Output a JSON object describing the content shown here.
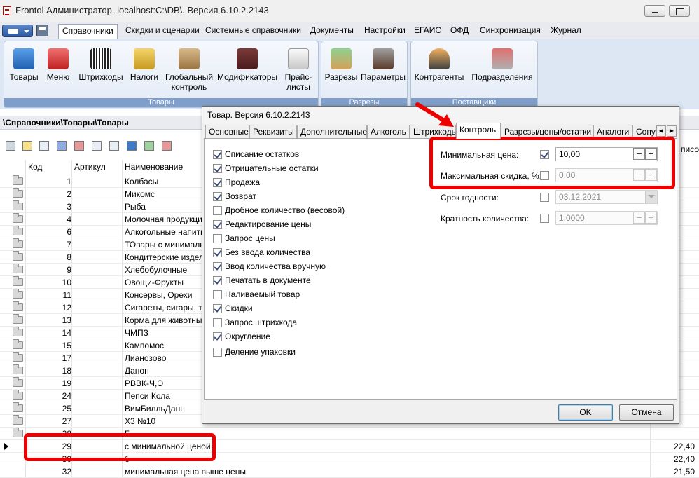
{
  "window": {
    "title": "Frontol Администратор. localhost:C:\\DB\\. Версия 6.10.2.2143"
  },
  "menu": {
    "tabs": [
      {
        "label": "Справочники",
        "active": true
      },
      {
        "label": "Скидки и сценарии"
      },
      {
        "label": "Системные справочники"
      },
      {
        "label": "Документы"
      },
      {
        "label": "Настройки"
      },
      {
        "label": "ЕГАИС"
      },
      {
        "label": "ОФД"
      },
      {
        "label": "Синхронизация"
      },
      {
        "label": "Журнал"
      }
    ]
  },
  "ribbon": {
    "groups": [
      {
        "label": "Товары",
        "buttons": [
          {
            "line1": "Товары",
            "line2": ""
          },
          {
            "line1": "Меню",
            "line2": ""
          },
          {
            "line1": "Штрихкоды",
            "line2": ""
          },
          {
            "line1": "Налоги",
            "line2": ""
          },
          {
            "line1": "Глобальный",
            "line2": "контроль"
          },
          {
            "line1": "Модификаторы",
            "line2": ""
          },
          {
            "line1": "Прайс-",
            "line2": "листы"
          }
        ]
      },
      {
        "label": "Разрезы",
        "buttons": [
          {
            "line1": "Разрезы",
            "line2": ""
          },
          {
            "line1": "Параметры",
            "line2": ""
          }
        ]
      },
      {
        "label": "Поставщики",
        "buttons": [
          {
            "line1": "Контрагенты",
            "line2": ""
          },
          {
            "line1": "Подразделения",
            "line2": ""
          }
        ]
      }
    ]
  },
  "breadcrumb": "\\Справочники\\Товары\\Товары",
  "grid": {
    "columns": {
      "code": "Код",
      "article": "Артикул",
      "name": "Наименование",
      "right_cut": "писок"
    },
    "rows": [
      {
        "code": "1",
        "name": "Колбасы",
        "price": ""
      },
      {
        "code": "2",
        "name": "Микомс",
        "price": ""
      },
      {
        "code": "3",
        "name": "Рыба",
        "price": ""
      },
      {
        "code": "4",
        "name": "Молочная продукция",
        "price": ""
      },
      {
        "code": "6",
        "name": "Алкогольные напитки",
        "price": ""
      },
      {
        "code": "7",
        "name": "ТОвары с минимальной",
        "price": ""
      },
      {
        "code": "8",
        "name": "Кондитерские изделия",
        "price": ""
      },
      {
        "code": "9",
        "name": "Хлебобулочные",
        "price": ""
      },
      {
        "code": "10",
        "name": "Овощи-Фрукты",
        "price": ""
      },
      {
        "code": "11",
        "name": "Консервы, Орехи",
        "price": ""
      },
      {
        "code": "12",
        "name": "Сигареты, сигары, табак",
        "price": ""
      },
      {
        "code": "13",
        "name": "Корма для животных",
        "price": ""
      },
      {
        "code": "14",
        "name": "ЧМПЗ",
        "price": ""
      },
      {
        "code": "15",
        "name": "Кампомос",
        "price": ""
      },
      {
        "code": "17",
        "name": "Лианозово",
        "price": ""
      },
      {
        "code": "18",
        "name": "Данон",
        "price": ""
      },
      {
        "code": "19",
        "name": "РВВК-Ч,Э",
        "price": ""
      },
      {
        "code": "24",
        "name": "Пепси Кола",
        "price": ""
      },
      {
        "code": "25",
        "name": "ВимБилльДанн",
        "price": ""
      },
      {
        "code": "27",
        "name": "Х3 №10",
        "price": ""
      },
      {
        "code": "28",
        "name": "Б",
        "price": ""
      },
      {
        "code": "29",
        "name": "с минимальной ценой",
        "price": "22,40",
        "selected": true
      },
      {
        "code": "30",
        "name": "б",
        "price": "22,40"
      },
      {
        "code": "32",
        "name": "минимальная цена выше цены",
        "price": "21,50"
      }
    ]
  },
  "dialog": {
    "title": "Товар. Версия 6.10.2.2143",
    "tabs": [
      {
        "label": "Основные"
      },
      {
        "label": "Реквизиты"
      },
      {
        "label": "Дополнительные"
      },
      {
        "label": "Алкоголь"
      },
      {
        "label": "Штрихкоды"
      },
      {
        "label": "Контроль",
        "active": true
      },
      {
        "label": "Разрезы/цены/остатки"
      },
      {
        "label": "Аналоги"
      },
      {
        "label": "Сопут"
      }
    ],
    "checkboxes": [
      {
        "label": "Списание остатков",
        "checked": true
      },
      {
        "label": "Отрицательные остатки",
        "checked": true
      },
      {
        "label": "Продажа",
        "checked": true
      },
      {
        "label": "Возврат",
        "checked": true
      },
      {
        "label": "Дробное количество (весовой)",
        "checked": false
      },
      {
        "label": "Редактирование цены",
        "checked": true
      },
      {
        "label": "Запрос цены",
        "checked": false
      },
      {
        "label": "Без ввода количества",
        "checked": true
      },
      {
        "label": "Ввод количества вручную",
        "checked": true
      },
      {
        "label": "Печатать в документе",
        "checked": true
      },
      {
        "label": "Наливаемый товар",
        "checked": false
      },
      {
        "label": "Скидки",
        "checked": true
      },
      {
        "label": "Запрос штрихкода",
        "checked": false
      },
      {
        "label": "Округление",
        "checked": true
      },
      {
        "label": "Деление упаковки",
        "checked": false
      }
    ],
    "fields": [
      {
        "label": "Минимальная цена:",
        "checked": true,
        "value": "10,00",
        "kind": "spin",
        "enabled": true
      },
      {
        "label": "Максимальная скидка, %:",
        "checked": false,
        "value": "0,00",
        "kind": "spin",
        "enabled": false
      },
      {
        "label": "Срок годности:",
        "checked": false,
        "value": "03.12.2021",
        "kind": "date",
        "enabled": false
      },
      {
        "label": "Кратность количества:",
        "checked": false,
        "value": "1,0000",
        "kind": "spin",
        "enabled": false
      }
    ],
    "ok_label": "OK",
    "cancel_label": "Отмена"
  },
  "annotation": {
    "highlight_color": "#ee0000"
  }
}
